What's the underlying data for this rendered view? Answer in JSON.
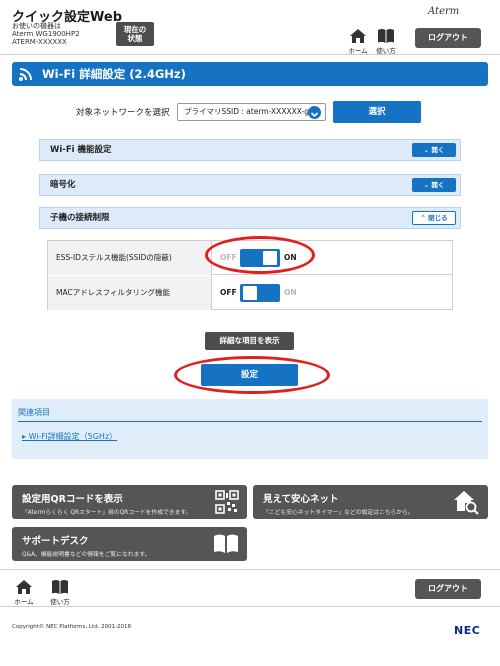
{
  "header": {
    "title": "クイック設定Web",
    "device_caption": "お使いの機器は",
    "model": "Aterm WG1900HP2",
    "device_name": "ATERM-XXXXXX",
    "status_button": [
      "現在の",
      "状態"
    ],
    "logo": "Aterm",
    "home_label": "ホーム",
    "howto_label": "使い方",
    "logout_label": "ログアウト"
  },
  "section": {
    "title": "Wi-Fi 詳細設定 (2.4GHz)"
  },
  "network_select": {
    "label": "対象ネットワークを選択",
    "value": "プライマリSSID : aterm-XXXXXX-g",
    "button": "選択"
  },
  "accordions": [
    {
      "label": "Wi-Fi 機能設定",
      "button": "開く",
      "state": "collapsed"
    },
    {
      "label": "暗号化",
      "button": "開く",
      "state": "collapsed"
    },
    {
      "label": "子機の接続制限",
      "button": "閉じる",
      "state": "expanded"
    }
  ],
  "settings_rows": [
    {
      "label": "ESS-IDステルス機能(SSIDの隠蔽)",
      "off": "OFF",
      "on": "ON",
      "value": "ON"
    },
    {
      "label": "MACアドレスフィルタリング機能",
      "off": "OFF",
      "on": "ON",
      "value": "OFF"
    }
  ],
  "detail_button": "詳細な項目を表示",
  "submit_button": "設定",
  "related": {
    "title": "関連項目",
    "link": "Wi-Fi詳細設定（5GHz）"
  },
  "cards": [
    {
      "title": "設定用QRコードを表示",
      "desc": "「Atermらくらく QRスタート」用のQRコードを作成できます。",
      "icon": "qr-code-icon"
    },
    {
      "title": "見えて安心ネット",
      "desc": "「こども安心ネットタイマー」などの設定はこちらから。",
      "icon": "home-search-icon"
    },
    {
      "title": "サポートデスク",
      "desc": "Q&A、機能説明書などの情報をご覧になれます。",
      "icon": "book-icon"
    }
  ],
  "footer": {
    "home_label": "ホーム",
    "howto_label": "使い方",
    "logout_label": "ログアウト",
    "copyright": "Copyright© NEC Platforms, Ltd. 2001-2018",
    "brand": "NEC"
  },
  "colors": {
    "accent": "#1673c4",
    "highlight": "#e02020",
    "dark_button": "#555555"
  }
}
